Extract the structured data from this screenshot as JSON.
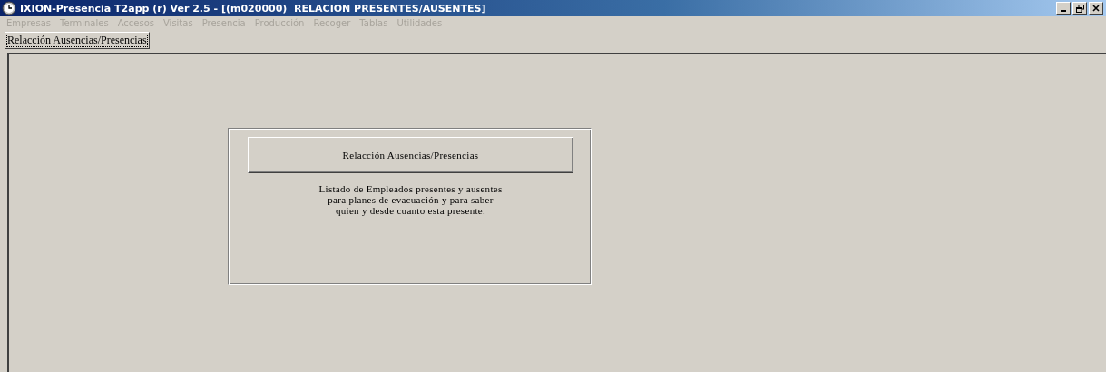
{
  "window": {
    "title": "IXION-Presencia T2app (r) Ver 2.5 - [(m020000)  RELACION PRESENTES/AUSENTES]"
  },
  "menu": [
    {
      "label": "Empresas",
      "disabled": true
    },
    {
      "label": "Terminales",
      "disabled": true
    },
    {
      "label": "Accesos",
      "disabled": true
    },
    {
      "label": "Visitas",
      "disabled": true
    },
    {
      "label": "Presencia",
      "disabled": true
    },
    {
      "label": "Producción",
      "disabled": true
    },
    {
      "label": "Recoger",
      "disabled": true
    },
    {
      "label": "Tablas",
      "disabled": true
    },
    {
      "label": "Utilidades",
      "disabled": true
    }
  ],
  "tabs": [
    {
      "label": "Relacción Ausencias/Presencias",
      "selected": true
    }
  ],
  "card": {
    "button": "Relacción Ausencias/Presencias",
    "description": [
      "Listado de Empleados presentes y ausentes",
      "para planes de evacuación y para saber",
      "quien y desde cuanto esta presente."
    ]
  }
}
